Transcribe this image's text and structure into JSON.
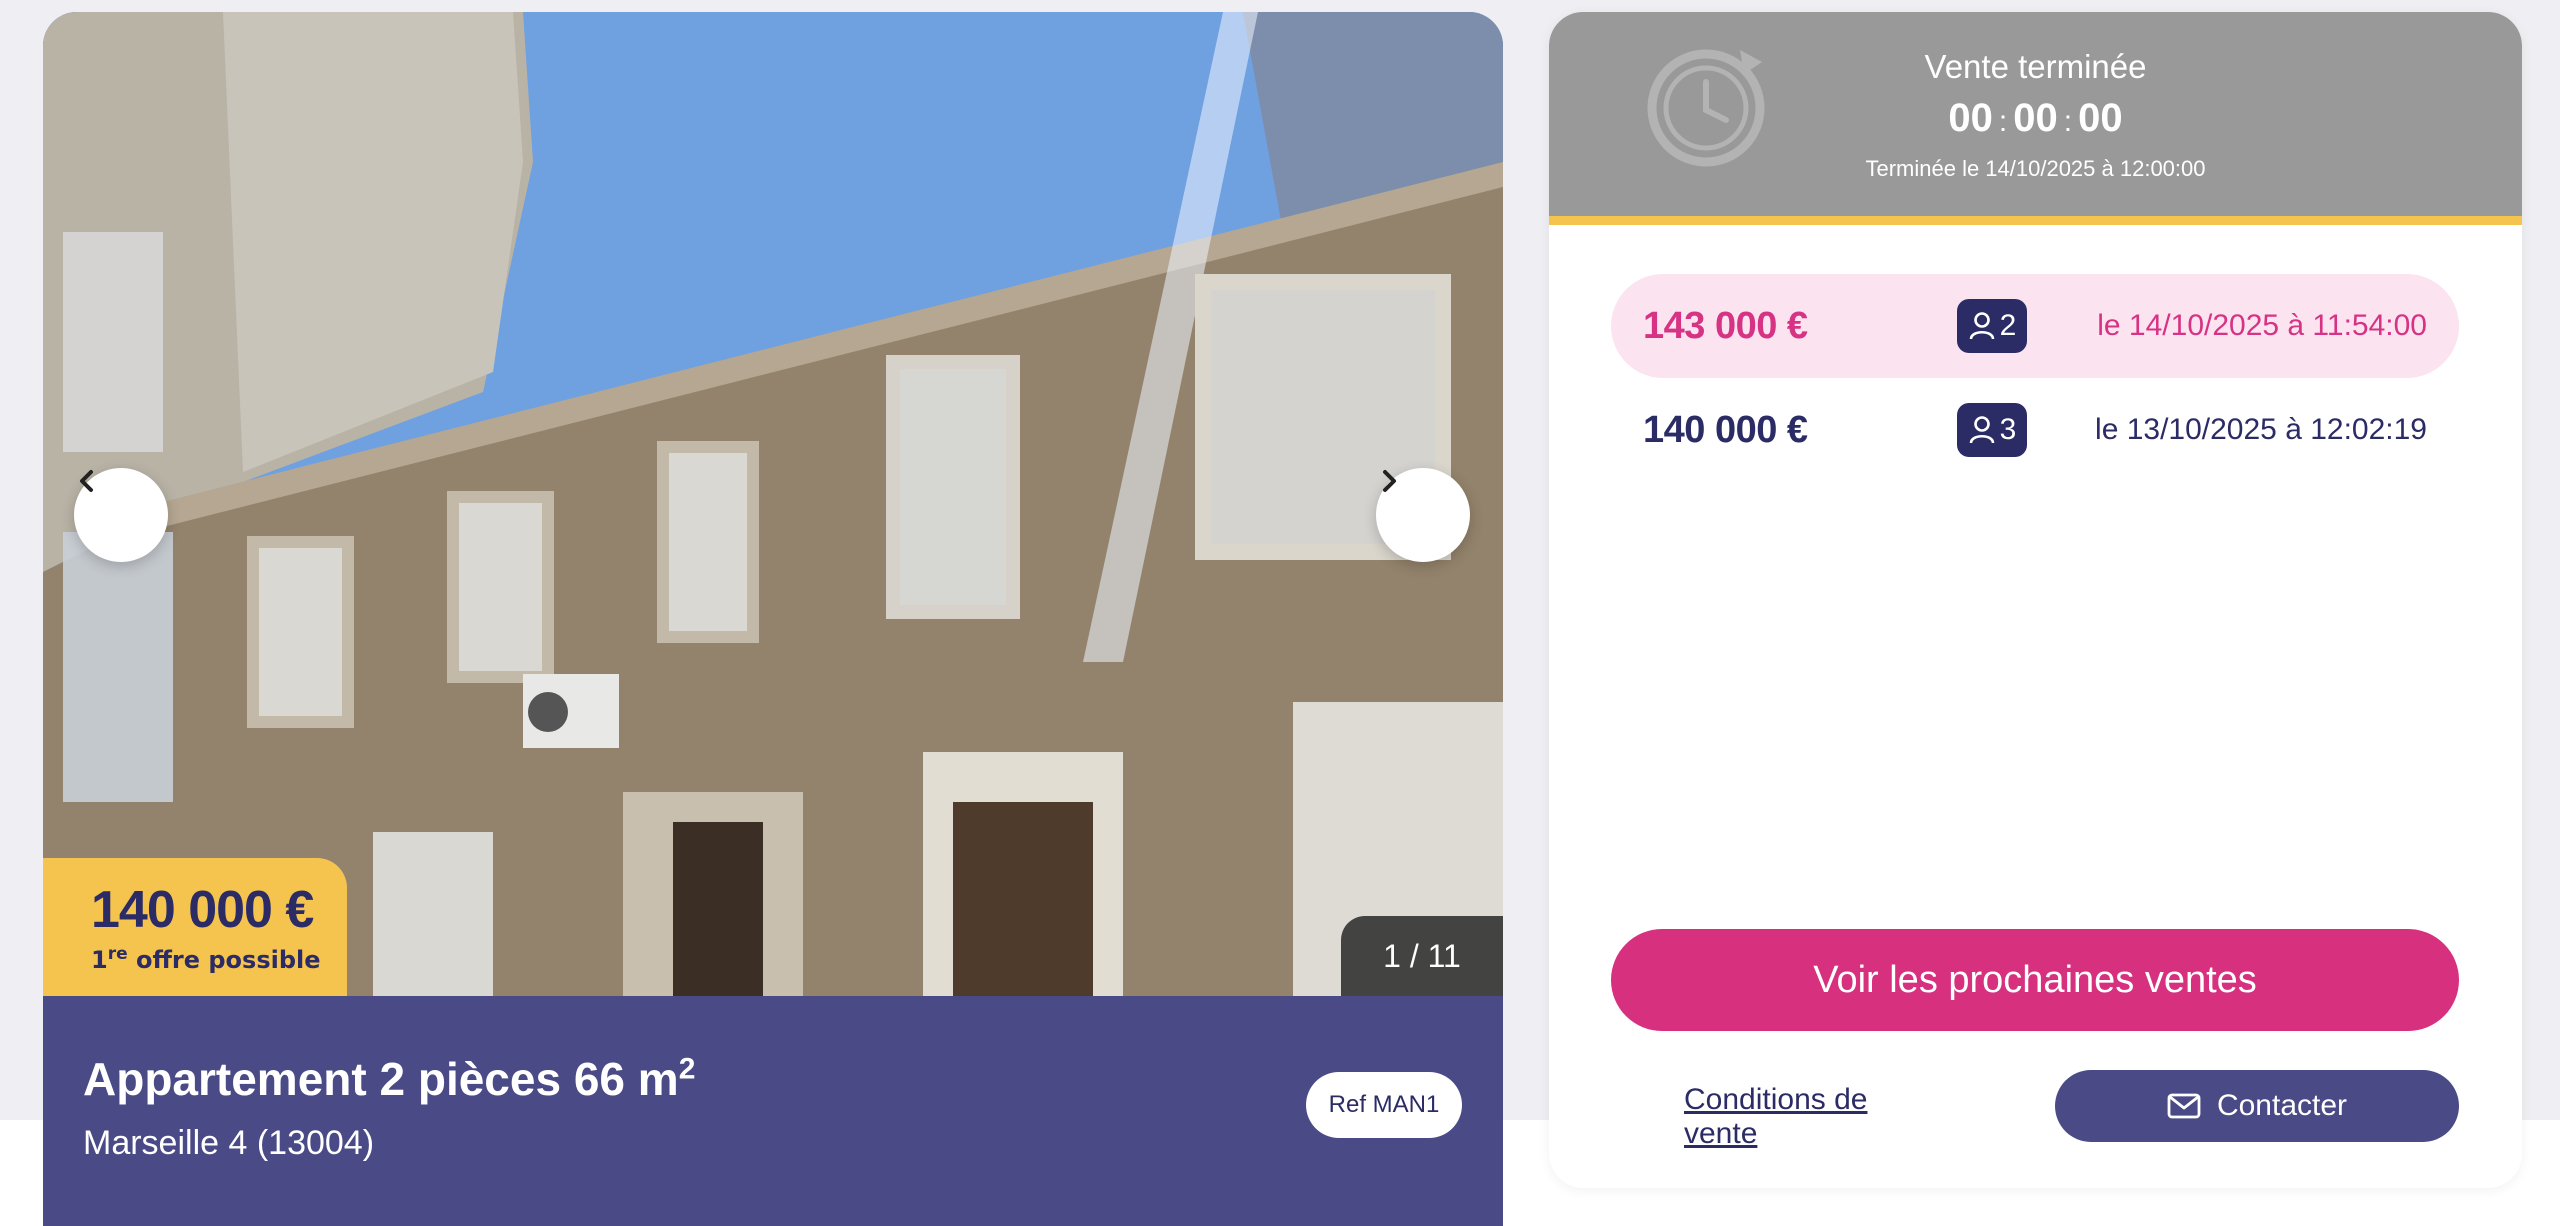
{
  "listing": {
    "price": "140 000 €",
    "first_offer_prefix": "1",
    "first_offer_sup": "re",
    "first_offer_suffix": " offre possible",
    "photo_counter": "1 / 11",
    "title_main": "Appartement 2 pièces 66 m",
    "title_sup": "2",
    "location": "Marseille 4 (13004)",
    "ref": "Ref MAN1",
    "icons": {
      "prev": "chevron-left-icon",
      "next": "chevron-right-icon"
    }
  },
  "auction": {
    "status_label": "Vente terminée",
    "timer": {
      "hours": "00",
      "minutes": "00",
      "seconds": "00",
      "separator": ":"
    },
    "ended_text": "Terminée le 14/10/2025 à 12:00:00",
    "bids": [
      {
        "amount": "143 000 €",
        "bidder_count": "2",
        "date": "le 14/10/2025 à 11:54:00",
        "highlighted": true
      },
      {
        "amount": "140 000 €",
        "bidder_count": "3",
        "date": "le 13/10/2025 à 12:02:19",
        "highlighted": false
      }
    ],
    "cta_label": "Voir les prochaines ventes",
    "conditions_label": "Conditions de vente",
    "contact_label": "Contacter"
  },
  "colors": {
    "navy": "#2b2b66",
    "indigo": "#4a4a86",
    "pink": "#d6307f",
    "pink_light": "#fbe3f0",
    "yellow": "#f5c44f",
    "gray_header": "#999999"
  }
}
